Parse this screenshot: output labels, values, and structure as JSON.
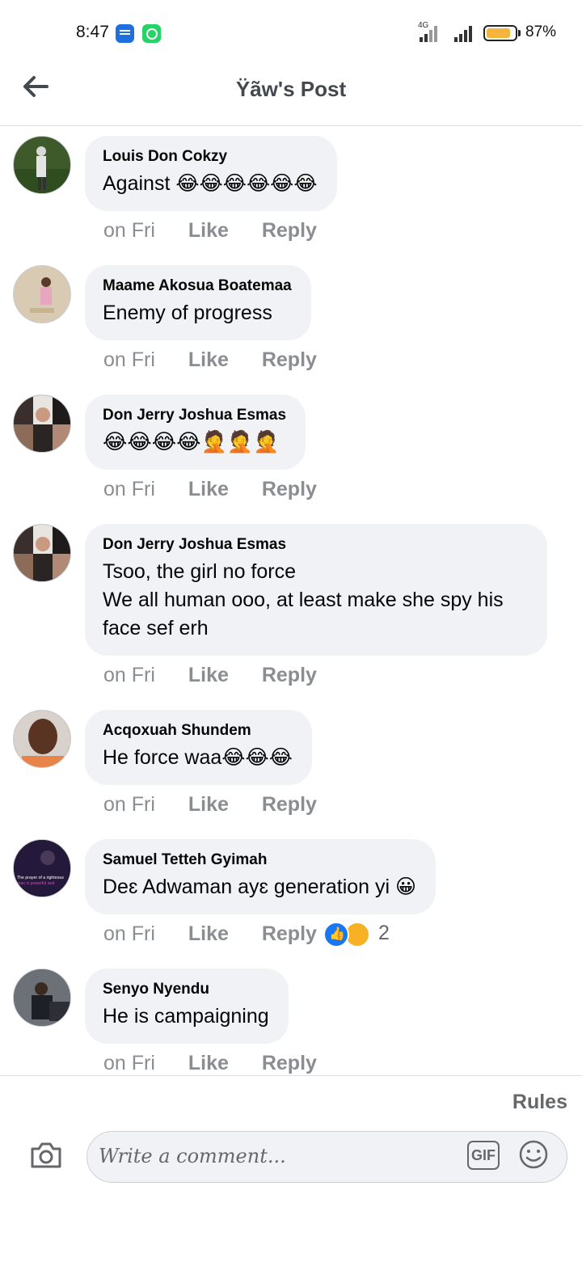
{
  "status_bar": {
    "time": "8:47",
    "network": "4G",
    "battery": "87%",
    "battery_level": 0.87
  },
  "header": {
    "title": "Ÿãw's Post",
    "back_icon": "arrow-left-icon"
  },
  "comments": [
    {
      "author": "Louis Don Cokzy",
      "text": "Against 😂😂😂😂😂😂",
      "time": "on Fri",
      "like": "Like",
      "reply": "Reply",
      "avatar_color": "#3e5a2a"
    },
    {
      "author": "Maame Akosua Boatemaa",
      "text": "Enemy of progress",
      "time": "on Fri",
      "like": "Like",
      "reply": "Reply",
      "avatar_color": "#cdb99c"
    },
    {
      "author": "Don Jerry Joshua Esmas",
      "text": "😂😂😂😂🤦🤦🤦",
      "time": "on Fri",
      "like": "Like",
      "reply": "Reply",
      "avatar_color": "#5b4b45"
    },
    {
      "author": "Don Jerry Joshua Esmas",
      "text": "Tsoo, the girl no force\nWe all human ooo, at least make she spy his face sef erh",
      "time": "on Fri",
      "like": "Like",
      "reply": "Reply",
      "avatar_color": "#5b4b45"
    },
    {
      "author": "Acqoxuah Shundem",
      "text": "He force waa😂😂😂",
      "time": "on Fri",
      "like": "Like",
      "reply": "Reply",
      "avatar_color": "#c9764a"
    },
    {
      "author": "Samuel Tetteh Gyimah",
      "text": "Deɛ Adwaman ayɛ generation yi 😀",
      "time": "on Fri",
      "like": "Like",
      "reply": "Reply",
      "reaction_count": "2",
      "avatar_color": "#2b2140"
    },
    {
      "author": "Senyo Nyendu",
      "text": "He is campaigning",
      "time": "on Fri",
      "like": "Like",
      "reply": "Reply",
      "avatar_color": "#4a4f57"
    }
  ],
  "avatar_text": {
    "line1": "The prayer of a righteous",
    "line2": "man is powerful and"
  },
  "composer": {
    "rules": "Rules",
    "placeholder": "Write a comment...",
    "gif": "GIF"
  }
}
